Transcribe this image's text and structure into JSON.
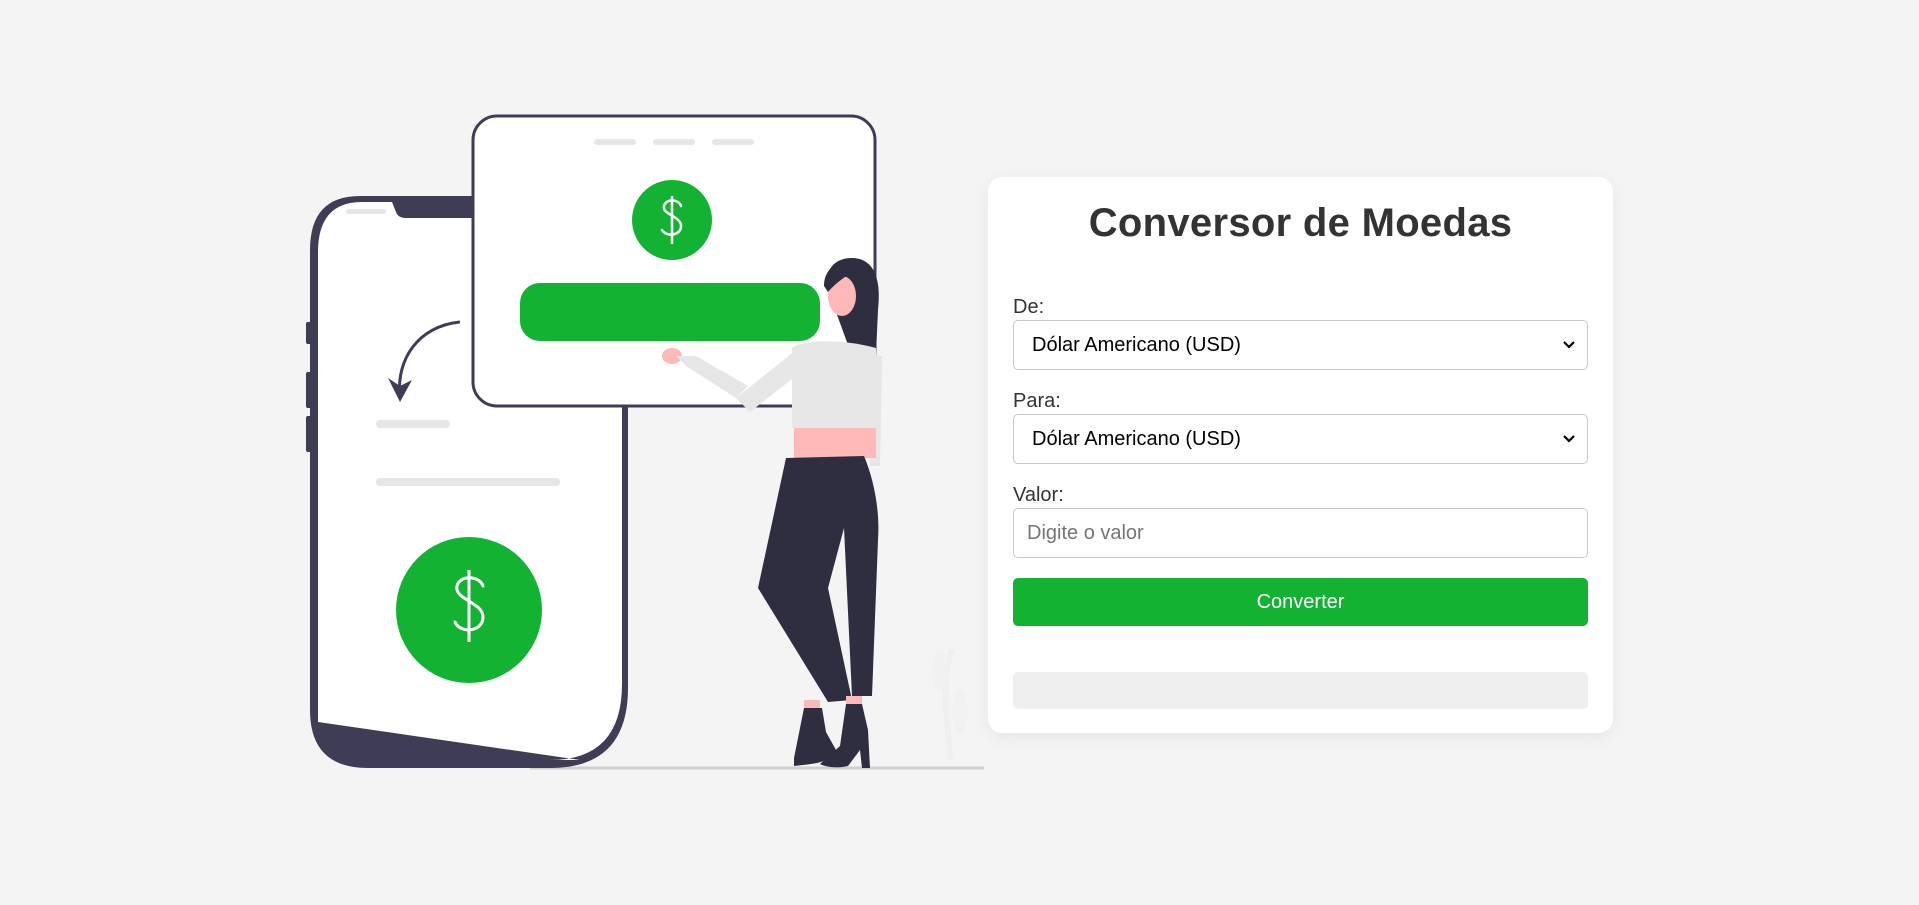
{
  "converter": {
    "title": "Conversor de Moedas",
    "from_label": "De:",
    "from_selected": "Dólar Americano (USD)",
    "to_label": "Para:",
    "to_selected": "Dólar Americano (USD)",
    "amount_label": "Valor:",
    "amount_placeholder": "Digite o valor",
    "amount_value": "",
    "convert_button": "Converter",
    "result_text": ""
  },
  "colors": {
    "accent": "#13b232",
    "ink": "#3f3d56",
    "background": "#f4f4f4"
  },
  "illustration": {
    "icons": [
      "dollar-coin-icon",
      "dollar-coin-icon",
      "curved-arrow-icon"
    ]
  }
}
